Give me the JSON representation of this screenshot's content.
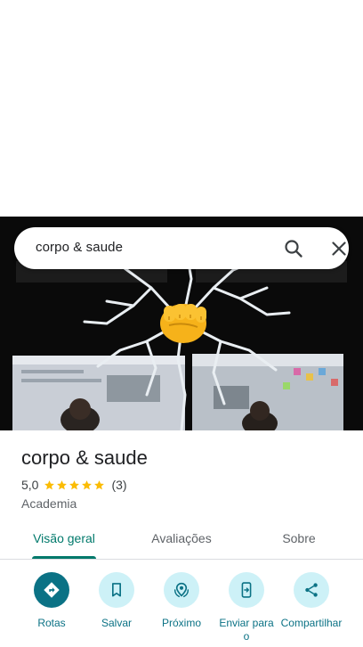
{
  "search": {
    "query": "corpo & saude"
  },
  "place": {
    "name": "corpo & saude",
    "rating": "5,0",
    "stars": 5,
    "reviews_count": "(3)",
    "category": "Academia"
  },
  "tabs": [
    {
      "label": "Visão geral",
      "active": true
    },
    {
      "label": "Avaliações",
      "active": false
    },
    {
      "label": "Sobre",
      "active": false
    }
  ],
  "actions": [
    {
      "label": "Rotas",
      "icon": "directions-icon"
    },
    {
      "label": "Salvar",
      "icon": "bookmark-icon"
    },
    {
      "label": "Próximo",
      "icon": "nearby-icon"
    },
    {
      "label": "Enviar para o",
      "icon": "send-to-phone-icon"
    },
    {
      "label": "Compartilhar",
      "icon": "share-icon"
    }
  ],
  "colors": {
    "accent": "#00796b",
    "action_bg": "#cdf1f7",
    "action_primary": "#0b7285",
    "star": "#fbbc04"
  }
}
